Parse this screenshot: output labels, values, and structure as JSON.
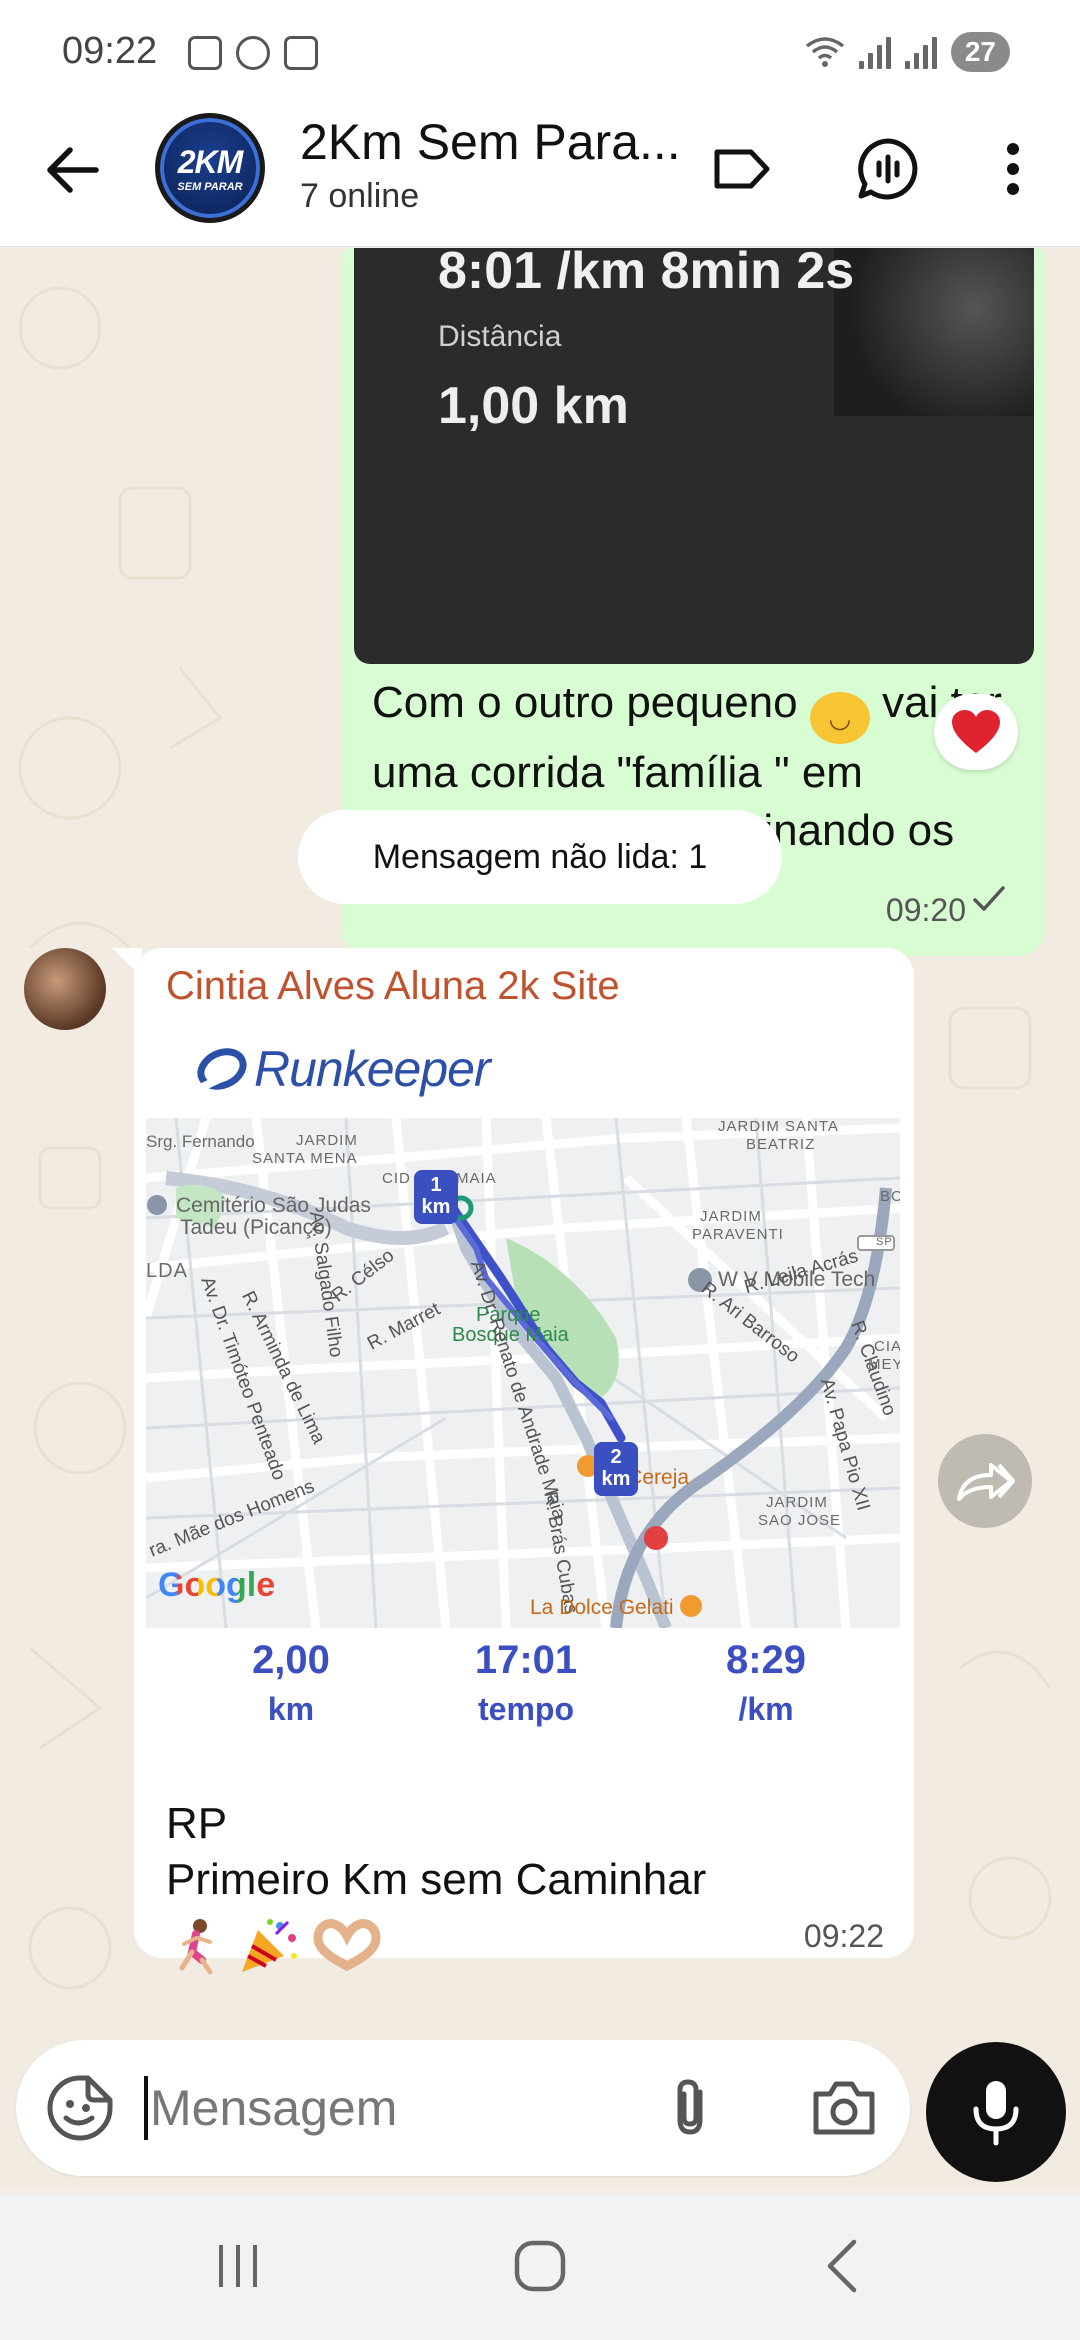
{
  "status_bar": {
    "time": "09:22",
    "battery": "27"
  },
  "header": {
    "group_name": "2Km Sem Para...",
    "group_status": "7 online",
    "avatar_line1": "2KM",
    "avatar_line2": "SEM PARAR"
  },
  "outgoing_message": {
    "card_pace": "8:01 /km 8min 2s",
    "card_distance_label": "Distância",
    "card_distance_value": "1,00 km",
    "text_part1": "Com o outro pequeno",
    "text_part2": " vai ter uma corrida \"família \" em novembro, estou treinando os dois",
    "time": "09:20",
    "reaction": "heart-emoji"
  },
  "unread_banner": "Mensagem não lida: 1",
  "incoming_message": {
    "sender": "Cintia Alves Aluna 2k Site",
    "app_name": "Runkeeper",
    "map": {
      "labels": [
        "Srg. Fernando",
        "JARDIM",
        "SANTA MENA",
        "CID",
        "MAIA",
        "Cemitério São Judas",
        "Tadeu (Picanço)",
        "LDA",
        "JARDIM SANTA",
        "BEATRIZ",
        "JARDIM",
        "PARAVENTI",
        "W V Mobile Tech",
        "Parque",
        "Bosque Maia",
        "Av. Dr. Renato de Andrade Maia",
        "Av. Salgado Filho",
        "Av. Dr. Timóteo Penteado",
        "R. Arminda de Lima",
        "R. Célso",
        "R. Marret",
        "R. Leila Acrás",
        "R. Ari Barroso",
        "R. Claudino",
        "Av. Papa Pio XII",
        "ria Cereja",
        "JARDIM",
        "SAO JOSE",
        "R. Brás Cubas",
        "ra. Mãe dos Homens",
        "La Dolce Gelati",
        "BO",
        "SP",
        "CIA",
        "MEYR"
      ],
      "markers": [
        "1",
        "2"
      ],
      "marker_unit": "km",
      "google": "Google"
    },
    "stats": [
      {
        "value": "2,00",
        "unit": "km"
      },
      {
        "value": "17:01",
        "unit": "tempo"
      },
      {
        "value": "8:29",
        "unit": "/km"
      }
    ],
    "text_line1": "RP",
    "text_line2": "Primeiro Km sem Caminhar",
    "emojis": [
      "woman-running-emoji",
      "party-popper-emoji",
      "heart-hands-emoji"
    ],
    "time": "09:22"
  },
  "input_bar": {
    "placeholder": "Mensagem"
  },
  "colors": {
    "outgoing_bubble": "#d9fdd3",
    "incoming_bubble": "#ffffff",
    "sender_name": "#c0522e",
    "runkeeper_blue": "#2c4fa8",
    "stats_blue": "#3c4fc0",
    "route": "#3f51c8",
    "mic_button": "#111111"
  }
}
